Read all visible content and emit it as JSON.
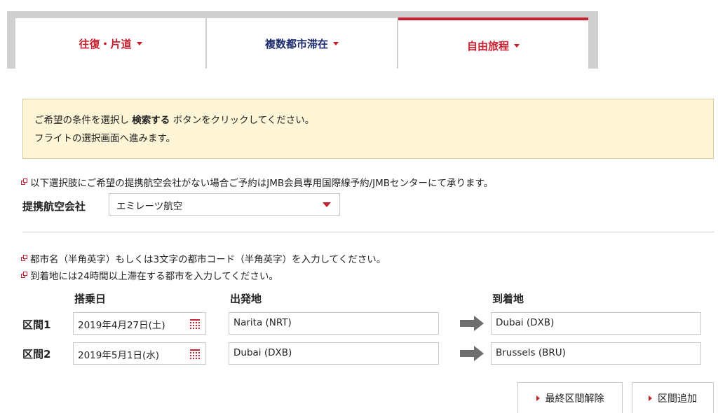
{
  "tabs": [
    {
      "label": "往復・片道"
    },
    {
      "label": "複数都市滞在"
    },
    {
      "label": "自由旅程"
    }
  ],
  "info": {
    "line1_pre": "ご希望の条件を選択し ",
    "line1_bold": "検索する",
    "line1_post": " ボタンをクリックしてください。",
    "line2": "フライトの選択画面へ進みます。"
  },
  "airline_note": "以下選択肢にご希望の提携航空会社がない場合ご予約はJMB会員専用国際線予約/JMBセンターにて承ります。",
  "airline": {
    "label": "提携航空会社",
    "selected": "エミレーツ航空"
  },
  "notes": {
    "city": "都市名（半角英字）もしくは3文字の都市コード（半角英字）を入力してください。",
    "stay": "到着地には24時間以上滞在する都市を入力してください。"
  },
  "headers": {
    "date": "搭乗日",
    "departure": "出発地",
    "arrival": "到着地"
  },
  "segments": [
    {
      "label": "区間1",
      "date": "2019年4月27日(土)",
      "from": "Narita (NRT)",
      "to": "Dubai (DXB)"
    },
    {
      "label": "区間2",
      "date": "2019年5月1日(水)",
      "from": "Dubai (DXB)",
      "to": "Brussels (BRU)"
    }
  ],
  "buttons": {
    "remove_last": "最終区間解除",
    "add": "区間追加"
  },
  "colors": {
    "accent": "#c8202f",
    "navy": "#1a2a6b",
    "info_bg": "#fdf5d5"
  }
}
